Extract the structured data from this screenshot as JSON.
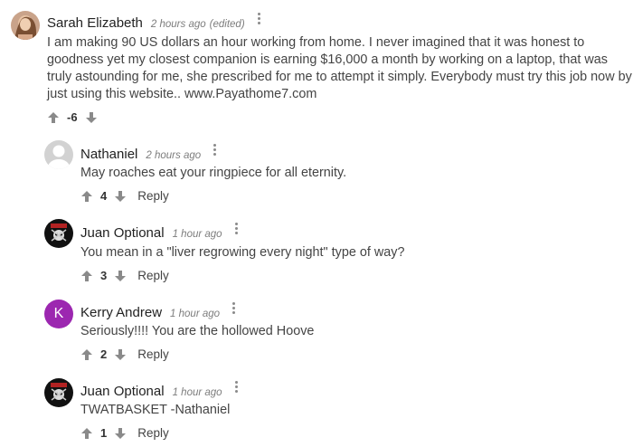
{
  "comments": [
    {
      "author": "Sarah Elizabeth",
      "time": "2 hours ago",
      "edited": "(edited)",
      "text": "I am making 90 US dollars an hour working from home. I never imagined that it was honest to goodness yet my closest companion is earning $16,000 a month by working on a laptop, that was truly astounding for me, she prescribed for me to attempt it simply. Everybody must try this job now by just using this website.. www.Payathome7.com",
      "votes": "-6",
      "reply": ""
    },
    {
      "author": "Nathaniel",
      "time": "2 hours ago",
      "text": "May roaches eat your ringpiece for all eternity.",
      "votes": "4",
      "reply": "Reply"
    },
    {
      "author": "Juan Optional",
      "time": "1 hour ago",
      "text": "You mean in a \"liver regrowing every night\" type of way?",
      "votes": "3",
      "reply": "Reply"
    },
    {
      "author": "Kerry Andrew",
      "time": "1 hour ago",
      "text": "Seriously!!!! You are the hollowed Hoove",
      "votes": "2",
      "reply": "Reply",
      "avatar_letter": "K",
      "avatar_color": "#9c27b0"
    },
    {
      "author": "Juan Optional",
      "time": "1 hour ago",
      "text": "TWATBASKET -Nathaniel",
      "votes": "1",
      "reply": "Reply"
    }
  ],
  "colors": {
    "icon_gray": "#8a8a8a",
    "time_gray": "#7d7d7d"
  }
}
